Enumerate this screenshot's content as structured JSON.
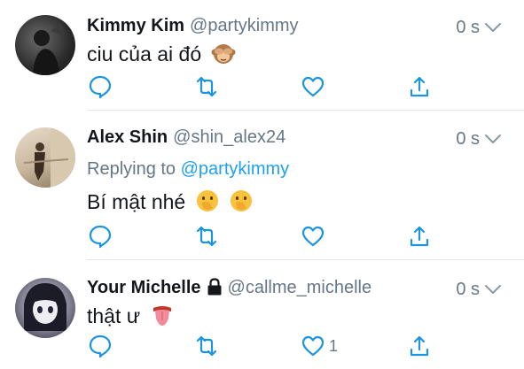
{
  "tweets": [
    {
      "name": "Kimmy Kim",
      "handle": "@partykimmy",
      "time": "0 s",
      "text": "ciu của ai đó",
      "emoji": "see-no-evil-monkey",
      "replying_label": "",
      "replying_to": "",
      "like_count": ""
    },
    {
      "name": "Alex Shin",
      "handle": "@shin_alex24",
      "time": "0 s",
      "text": "Bí mật nhé",
      "emoji": "hand-over-mouth-face x2",
      "replying_label": "Replying to",
      "replying_to": "@partykimmy",
      "like_count": ""
    },
    {
      "name": "Your Michelle",
      "handle": "@callme_michelle",
      "time": "0 s",
      "text": "thật ư",
      "emoji": "tongue",
      "replying_label": "",
      "replying_to": "",
      "like_count": "1",
      "protected": true
    }
  ],
  "colors": {
    "accent": "#1da1f2",
    "icon": "#1c94e0",
    "muted": "#657786",
    "text": "#14171a",
    "divider": "#e1e8ed"
  }
}
